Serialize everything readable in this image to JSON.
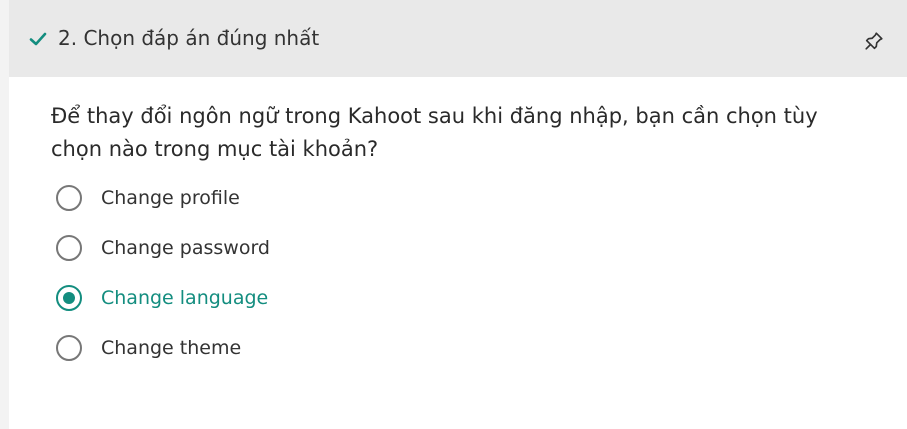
{
  "header": {
    "title": "2. Chọn đáp án đúng nhất",
    "check_icon": "check-icon",
    "pin_icon": "pin-icon"
  },
  "question": {
    "text": "Để thay đổi ngôn ngữ trong Kahoot sau khi đăng nhập, bạn cần chọn tùy chọn nào trong mục tài khoản?"
  },
  "options": [
    {
      "label": "Change profile",
      "selected": false
    },
    {
      "label": "Change password",
      "selected": false
    },
    {
      "label": "Change language",
      "selected": true
    },
    {
      "label": "Change theme",
      "selected": false
    }
  ],
  "colors": {
    "accent": "#138d7f",
    "header_bg": "#e9e9e9",
    "text": "#333333"
  }
}
